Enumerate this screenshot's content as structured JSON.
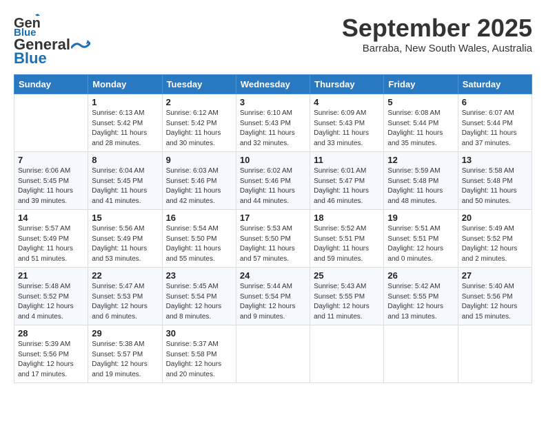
{
  "header": {
    "logo_general": "General",
    "logo_blue": "Blue",
    "month_title": "September 2025",
    "location": "Barraba, New South Wales, Australia"
  },
  "weekdays": [
    "Sunday",
    "Monday",
    "Tuesday",
    "Wednesday",
    "Thursday",
    "Friday",
    "Saturday"
  ],
  "weeks": [
    [
      {
        "day": "",
        "info": ""
      },
      {
        "day": "1",
        "info": "Sunrise: 6:13 AM\nSunset: 5:42 PM\nDaylight: 11 hours\nand 28 minutes."
      },
      {
        "day": "2",
        "info": "Sunrise: 6:12 AM\nSunset: 5:42 PM\nDaylight: 11 hours\nand 30 minutes."
      },
      {
        "day": "3",
        "info": "Sunrise: 6:10 AM\nSunset: 5:43 PM\nDaylight: 11 hours\nand 32 minutes."
      },
      {
        "day": "4",
        "info": "Sunrise: 6:09 AM\nSunset: 5:43 PM\nDaylight: 11 hours\nand 33 minutes."
      },
      {
        "day": "5",
        "info": "Sunrise: 6:08 AM\nSunset: 5:44 PM\nDaylight: 11 hours\nand 35 minutes."
      },
      {
        "day": "6",
        "info": "Sunrise: 6:07 AM\nSunset: 5:44 PM\nDaylight: 11 hours\nand 37 minutes."
      }
    ],
    [
      {
        "day": "7",
        "info": "Sunrise: 6:06 AM\nSunset: 5:45 PM\nDaylight: 11 hours\nand 39 minutes."
      },
      {
        "day": "8",
        "info": "Sunrise: 6:04 AM\nSunset: 5:45 PM\nDaylight: 11 hours\nand 41 minutes."
      },
      {
        "day": "9",
        "info": "Sunrise: 6:03 AM\nSunset: 5:46 PM\nDaylight: 11 hours\nand 42 minutes."
      },
      {
        "day": "10",
        "info": "Sunrise: 6:02 AM\nSunset: 5:46 PM\nDaylight: 11 hours\nand 44 minutes."
      },
      {
        "day": "11",
        "info": "Sunrise: 6:01 AM\nSunset: 5:47 PM\nDaylight: 11 hours\nand 46 minutes."
      },
      {
        "day": "12",
        "info": "Sunrise: 5:59 AM\nSunset: 5:48 PM\nDaylight: 11 hours\nand 48 minutes."
      },
      {
        "day": "13",
        "info": "Sunrise: 5:58 AM\nSunset: 5:48 PM\nDaylight: 11 hours\nand 50 minutes."
      }
    ],
    [
      {
        "day": "14",
        "info": "Sunrise: 5:57 AM\nSunset: 5:49 PM\nDaylight: 11 hours\nand 51 minutes."
      },
      {
        "day": "15",
        "info": "Sunrise: 5:56 AM\nSunset: 5:49 PM\nDaylight: 11 hours\nand 53 minutes."
      },
      {
        "day": "16",
        "info": "Sunrise: 5:54 AM\nSunset: 5:50 PM\nDaylight: 11 hours\nand 55 minutes."
      },
      {
        "day": "17",
        "info": "Sunrise: 5:53 AM\nSunset: 5:50 PM\nDaylight: 11 hours\nand 57 minutes."
      },
      {
        "day": "18",
        "info": "Sunrise: 5:52 AM\nSunset: 5:51 PM\nDaylight: 11 hours\nand 59 minutes."
      },
      {
        "day": "19",
        "info": "Sunrise: 5:51 AM\nSunset: 5:51 PM\nDaylight: 12 hours\nand 0 minutes."
      },
      {
        "day": "20",
        "info": "Sunrise: 5:49 AM\nSunset: 5:52 PM\nDaylight: 12 hours\nand 2 minutes."
      }
    ],
    [
      {
        "day": "21",
        "info": "Sunrise: 5:48 AM\nSunset: 5:52 PM\nDaylight: 12 hours\nand 4 minutes."
      },
      {
        "day": "22",
        "info": "Sunrise: 5:47 AM\nSunset: 5:53 PM\nDaylight: 12 hours\nand 6 minutes."
      },
      {
        "day": "23",
        "info": "Sunrise: 5:45 AM\nSunset: 5:54 PM\nDaylight: 12 hours\nand 8 minutes."
      },
      {
        "day": "24",
        "info": "Sunrise: 5:44 AM\nSunset: 5:54 PM\nDaylight: 12 hours\nand 9 minutes."
      },
      {
        "day": "25",
        "info": "Sunrise: 5:43 AM\nSunset: 5:55 PM\nDaylight: 12 hours\nand 11 minutes."
      },
      {
        "day": "26",
        "info": "Sunrise: 5:42 AM\nSunset: 5:55 PM\nDaylight: 12 hours\nand 13 minutes."
      },
      {
        "day": "27",
        "info": "Sunrise: 5:40 AM\nSunset: 5:56 PM\nDaylight: 12 hours\nand 15 minutes."
      }
    ],
    [
      {
        "day": "28",
        "info": "Sunrise: 5:39 AM\nSunset: 5:56 PM\nDaylight: 12 hours\nand 17 minutes."
      },
      {
        "day": "29",
        "info": "Sunrise: 5:38 AM\nSunset: 5:57 PM\nDaylight: 12 hours\nand 19 minutes."
      },
      {
        "day": "30",
        "info": "Sunrise: 5:37 AM\nSunset: 5:58 PM\nDaylight: 12 hours\nand 20 minutes."
      },
      {
        "day": "",
        "info": ""
      },
      {
        "day": "",
        "info": ""
      },
      {
        "day": "",
        "info": ""
      },
      {
        "day": "",
        "info": ""
      }
    ]
  ]
}
